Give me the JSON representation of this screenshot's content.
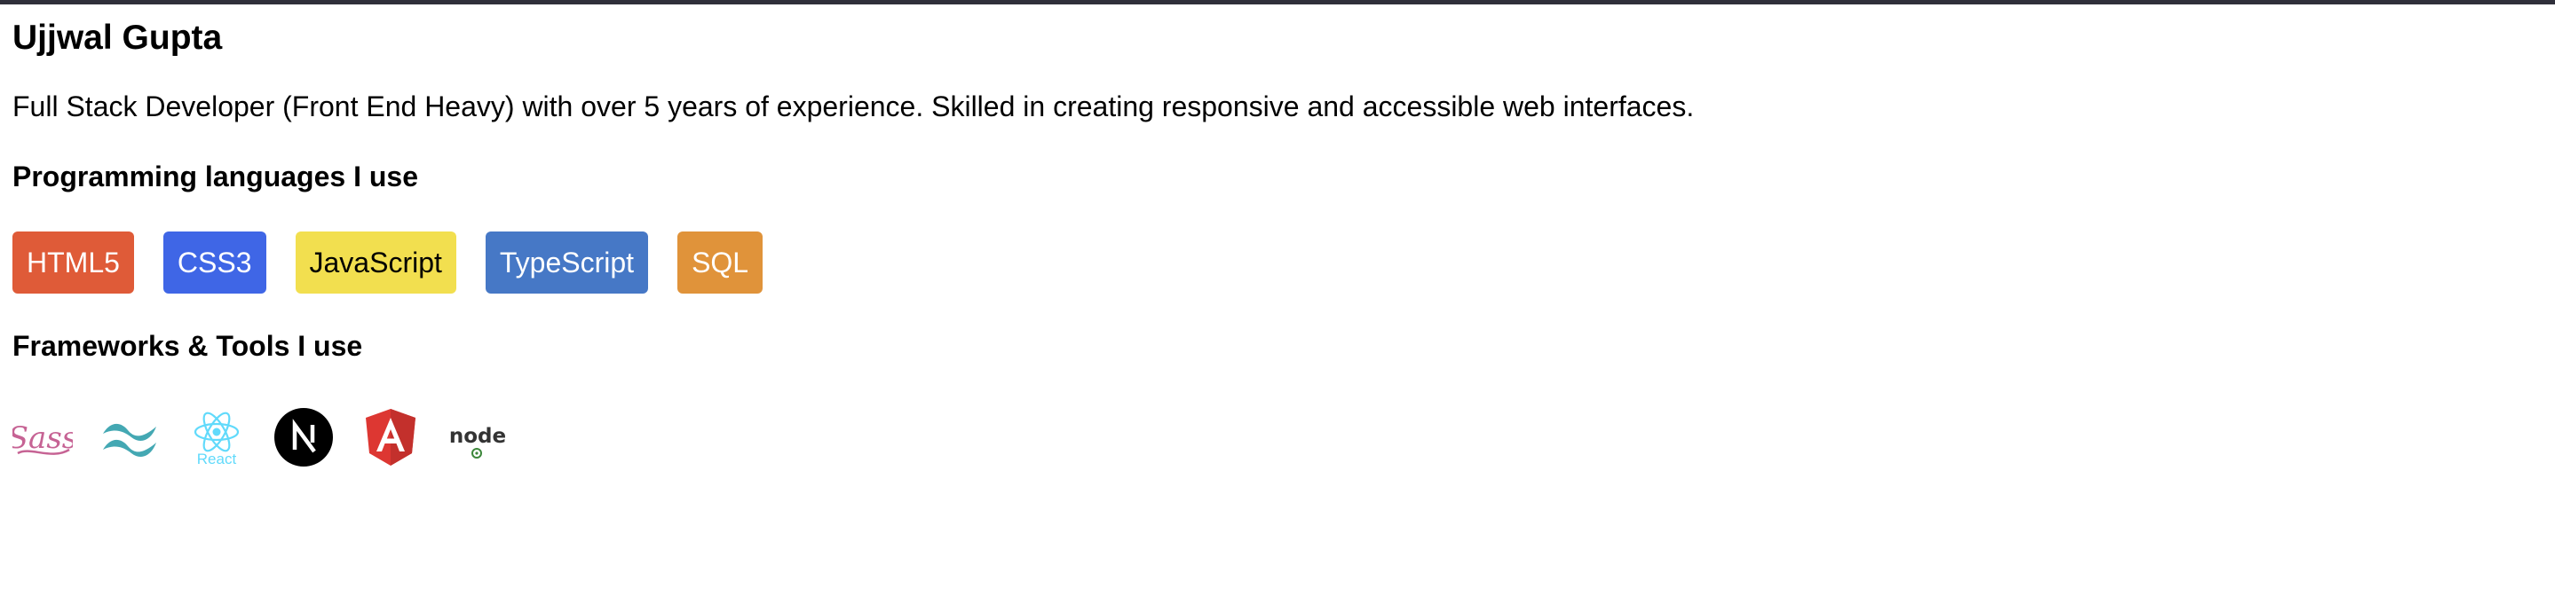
{
  "profile": {
    "name": "Ujjwal Gupta",
    "bio": "Full Stack Developer (Front End Heavy) with over 5 years of experience. Skilled in creating responsive and accessible web interfaces."
  },
  "languages": {
    "heading": "Programming languages I use",
    "items": [
      {
        "label": "HTML5",
        "bg": "#df5b38",
        "color": "#ffffff"
      },
      {
        "label": "CSS3",
        "bg": "#3f66e6",
        "color": "#ffffff"
      },
      {
        "label": "JavaScript",
        "bg": "#f2df4f",
        "color": "#000000"
      },
      {
        "label": "TypeScript",
        "bg": "#4678c6",
        "color": "#ffffff"
      },
      {
        "label": "SQL",
        "bg": "#e0933a",
        "color": "#ffffff"
      }
    ]
  },
  "tools": {
    "heading": "Frameworks & Tools I use",
    "items": [
      {
        "icon": "sass-icon",
        "wordmark": "Sass",
        "color": "#c66394"
      },
      {
        "icon": "tailwind-icon",
        "color": "#44a8b3"
      },
      {
        "icon": "react-icon",
        "wordmark": "React",
        "color": "#61dafb"
      },
      {
        "icon": "nextjs-icon",
        "color": "#000000"
      },
      {
        "icon": "angular-icon",
        "color": "#dd3732"
      },
      {
        "icon": "nodejs-icon",
        "wordmark": "node",
        "color": "#3c873a"
      }
    ]
  }
}
